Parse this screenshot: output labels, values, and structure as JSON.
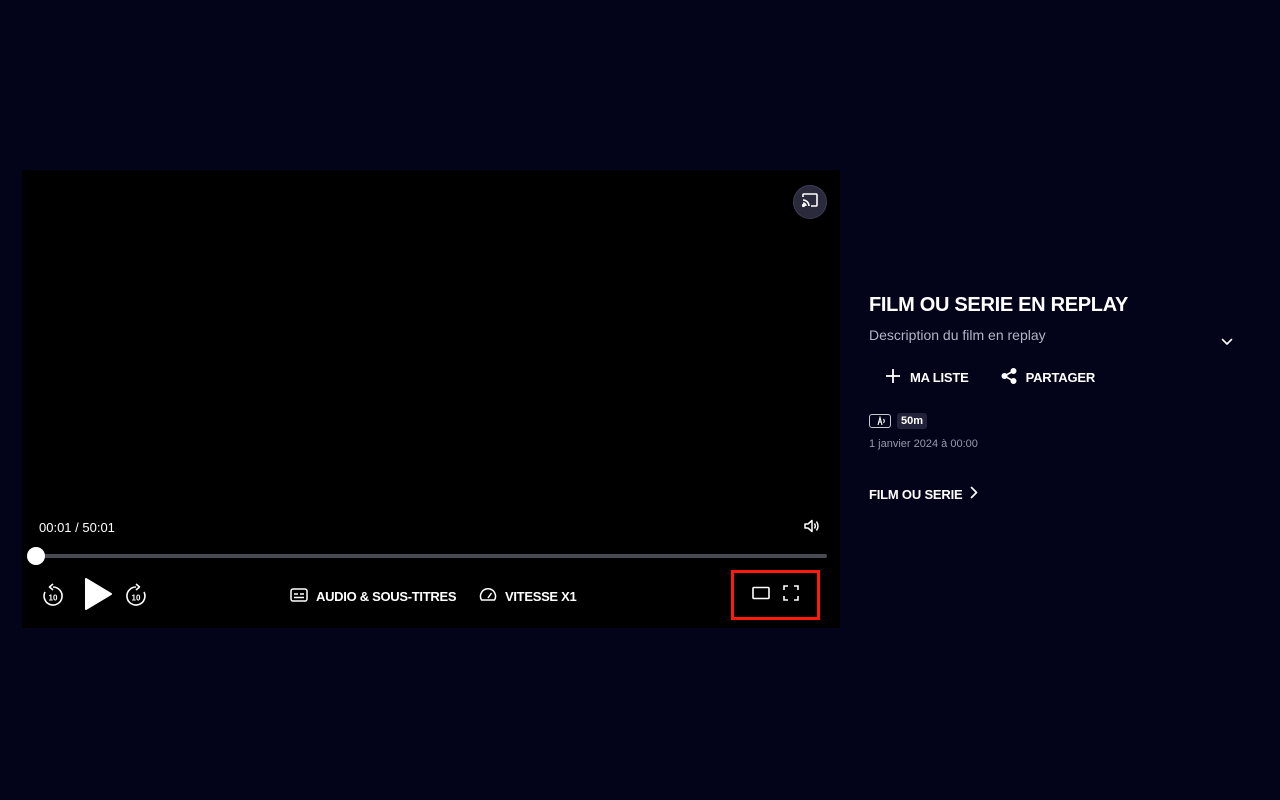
{
  "player": {
    "time_display": "00:01 / 50:01",
    "progress": 0.0003,
    "controls": {
      "audio_label": "AUDIO & SOUS-TITRES",
      "speed_label": "VITESSE X1"
    },
    "icons": {
      "cast": "cast-icon",
      "volume": "volume-icon",
      "rewind": "rewind-10-icon",
      "forward": "forward-10-icon",
      "rewind_number": "10",
      "forward_number": "10",
      "play": "play-icon",
      "subtitles": "subtitles-icon",
      "speed": "speedometer-icon",
      "theater": "theater-mode-icon",
      "fullscreen": "fullscreen-icon"
    },
    "highlight_color": "#ff1a0c"
  },
  "info": {
    "title": "FILM OU SERIE EN REPLAY",
    "description": "Description du film en replay",
    "actions": {
      "my_list_label": "MA LISTE",
      "share_label": "PARTAGER"
    },
    "duration_badge": "50m",
    "accessibility_badge_icon": "audio-description-icon",
    "date": "1 janvier 2024 à 00:00",
    "category_link": "FILM OU SERIE"
  },
  "colors": {
    "page_background": "#03031a",
    "player_background": "#000000",
    "description_text": "#b4b4c4"
  }
}
